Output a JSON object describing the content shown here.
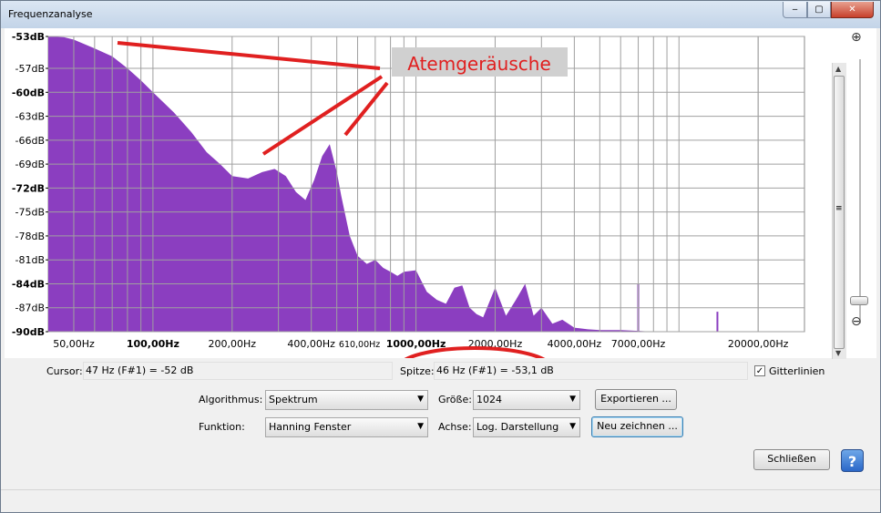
{
  "window": {
    "title": "Frequenzanalyse",
    "controls": {
      "minimize": "‒",
      "maximize": "▢",
      "close": "✕"
    }
  },
  "chart_data": {
    "type": "area",
    "x_scale": "log",
    "xlim": [
      40,
      30000
    ],
    "ylim": [
      -90,
      -53
    ],
    "grid": true,
    "fill_color": "#8b3ec0",
    "y_ticks": [
      "-53dB",
      "-57dB",
      "-60dB",
      "-63dB",
      "-66dB",
      "-69dB",
      "-72dB",
      "-75dB",
      "-78dB",
      "-81dB",
      "-84dB",
      "-87dB",
      "-90dB"
    ],
    "y_tick_values": [
      -53,
      -57,
      -60,
      -63,
      -66,
      -69,
      -72,
      -75,
      -78,
      -81,
      -84,
      -87,
      -90
    ],
    "y_tick_bold": [
      "-53dB",
      "-60dB",
      "-72dB",
      "-84dB",
      "-90dB"
    ],
    "x_ticks": [
      {
        "label": "50,00Hz",
        "value": 50
      },
      {
        "label": "100,00Hz",
        "value": 100,
        "bold": true
      },
      {
        "label": "200,00Hz",
        "value": 200
      },
      {
        "label": "400,00Hz",
        "value": 400
      },
      {
        "label": "610,00Hz",
        "value": 610,
        "small": true
      },
      {
        "label": "1000,00Hz",
        "value": 1000,
        "bold": true
      },
      {
        "label": "2000,00Hz",
        "value": 2000
      },
      {
        "label": "4000,00Hz",
        "value": 4000
      },
      {
        "label": "7000,00Hz",
        "value": 7000
      },
      {
        "label": "20000,00Hz",
        "value": 20000
      }
    ],
    "series": [
      {
        "x": [
          40,
          46,
          50,
          60,
          70,
          80,
          90,
          100,
          120,
          140,
          160,
          180,
          200,
          230,
          260,
          290,
          320,
          350,
          380,
          410,
          440,
          470,
          500,
          520,
          560,
          600,
          650,
          700,
          750,
          800,
          850,
          900,
          1000,
          1100,
          1200,
          1300,
          1400,
          1500,
          1600,
          1700,
          1800,
          2000,
          2200,
          2400,
          2600,
          2800,
          3000,
          3300,
          3600,
          4000,
          4500,
          5000,
          6000,
          7000,
          8000,
          10000,
          12000,
          15000,
          20000,
          25000,
          30000
        ],
        "y": [
          -53,
          -53.1,
          -53.4,
          -54.5,
          -55.5,
          -57,
          -58.5,
          -60,
          -62.5,
          -65,
          -67.5,
          -69,
          -70.5,
          -70.8,
          -70,
          -69.6,
          -70.5,
          -72.5,
          -73.5,
          -71,
          -68,
          -66.5,
          -70,
          -73,
          -78,
          -80.5,
          -81.5,
          -81,
          -82,
          -82.5,
          -83,
          -82.5,
          -82.3,
          -85,
          -86,
          -86.5,
          -84.5,
          -84.2,
          -87,
          -87.8,
          -88.2,
          -84.5,
          -88,
          -86,
          -84,
          -88,
          -87,
          -89,
          -88.5,
          -89.5,
          -89.7,
          -89.8,
          -89.8,
          -89.9,
          -90,
          -90,
          -90,
          -90,
          -90,
          -90,
          -90
        ]
      }
    ],
    "annotation": {
      "text": "Atemgeräusche"
    }
  },
  "cursor_row": {
    "cursor_label": "Cursor:",
    "cursor_value": "47 Hz (F#1) = -52 dB",
    "peak_label": "Spitze:",
    "peak_value": "46 Hz (F#1) = -53,1 dB",
    "gridlines_label": "Gitterlinien",
    "gridlines_checked": "✓"
  },
  "controls": {
    "algorithm_label": "Algorithmus:",
    "algorithm_value": "Spektrum",
    "size_label": "Größe:",
    "size_value": "1024",
    "function_label": "Funktion:",
    "function_value": "Hanning Fenster",
    "axis_label": "Achse:",
    "axis_value": "Log. Darstellung",
    "export_button": "Exportieren ...",
    "redraw_button": "Neu zeichnen ...",
    "close_button": "Schließen",
    "help_button": "?"
  },
  "zoom": {
    "zoom_in_icon": "⊕",
    "zoom_out_icon": "⊖",
    "scroll_up": "▲",
    "scroll_down": "▼",
    "scroll_grip": "≡"
  }
}
